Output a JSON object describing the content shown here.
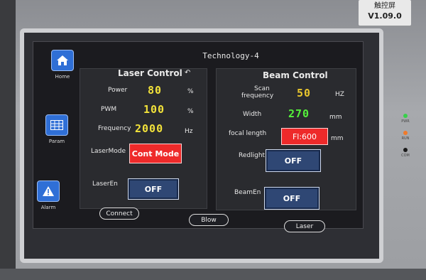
{
  "device": {
    "label_line1": "触控屏",
    "version": "V1.09.0",
    "leds": [
      {
        "label": "PWR",
        "color": "#38d04a"
      },
      {
        "label": "RUN",
        "color": "#f07a2a"
      },
      {
        "label": "COM",
        "color": "#1a1a1a"
      }
    ]
  },
  "screen": {
    "title": "Technology-4",
    "nav": [
      {
        "label": "Home",
        "icon": "home-icon"
      },
      {
        "label": "Param",
        "icon": "grid-icon"
      },
      {
        "label": "Alarm",
        "icon": "warning-icon"
      }
    ],
    "laser_control": {
      "title": "Laser Control",
      "power_label": "Power",
      "power_value": "80",
      "power_unit": "%",
      "pwm_label": "PWM",
      "pwm_value": "100",
      "pwm_unit": "%",
      "freq_label": "Frequency",
      "freq_value": "2000",
      "freq_unit": "Hz",
      "mode_label": "LaserMode",
      "mode_value": "Cont Mode",
      "en_label": "LaserEn",
      "en_value": "OFF"
    },
    "beam_control": {
      "title": "Beam Control",
      "scan_label_1": "Scan",
      "scan_label_2": "frequency",
      "scan_value": "50",
      "scan_unit": "HZ",
      "width_label": "Width",
      "width_value": "270",
      "width_unit": "mm",
      "focal_label": "focal length",
      "focal_value": "Fl:600",
      "focal_unit": "mm",
      "redlight_label": "Redlight",
      "redlight_value": "OFF",
      "beamen_label": "BeamEn",
      "beamen_value": "OFF"
    },
    "bottom": {
      "connect": "Connect",
      "blow": "Blow",
      "laser": "Laser"
    }
  }
}
